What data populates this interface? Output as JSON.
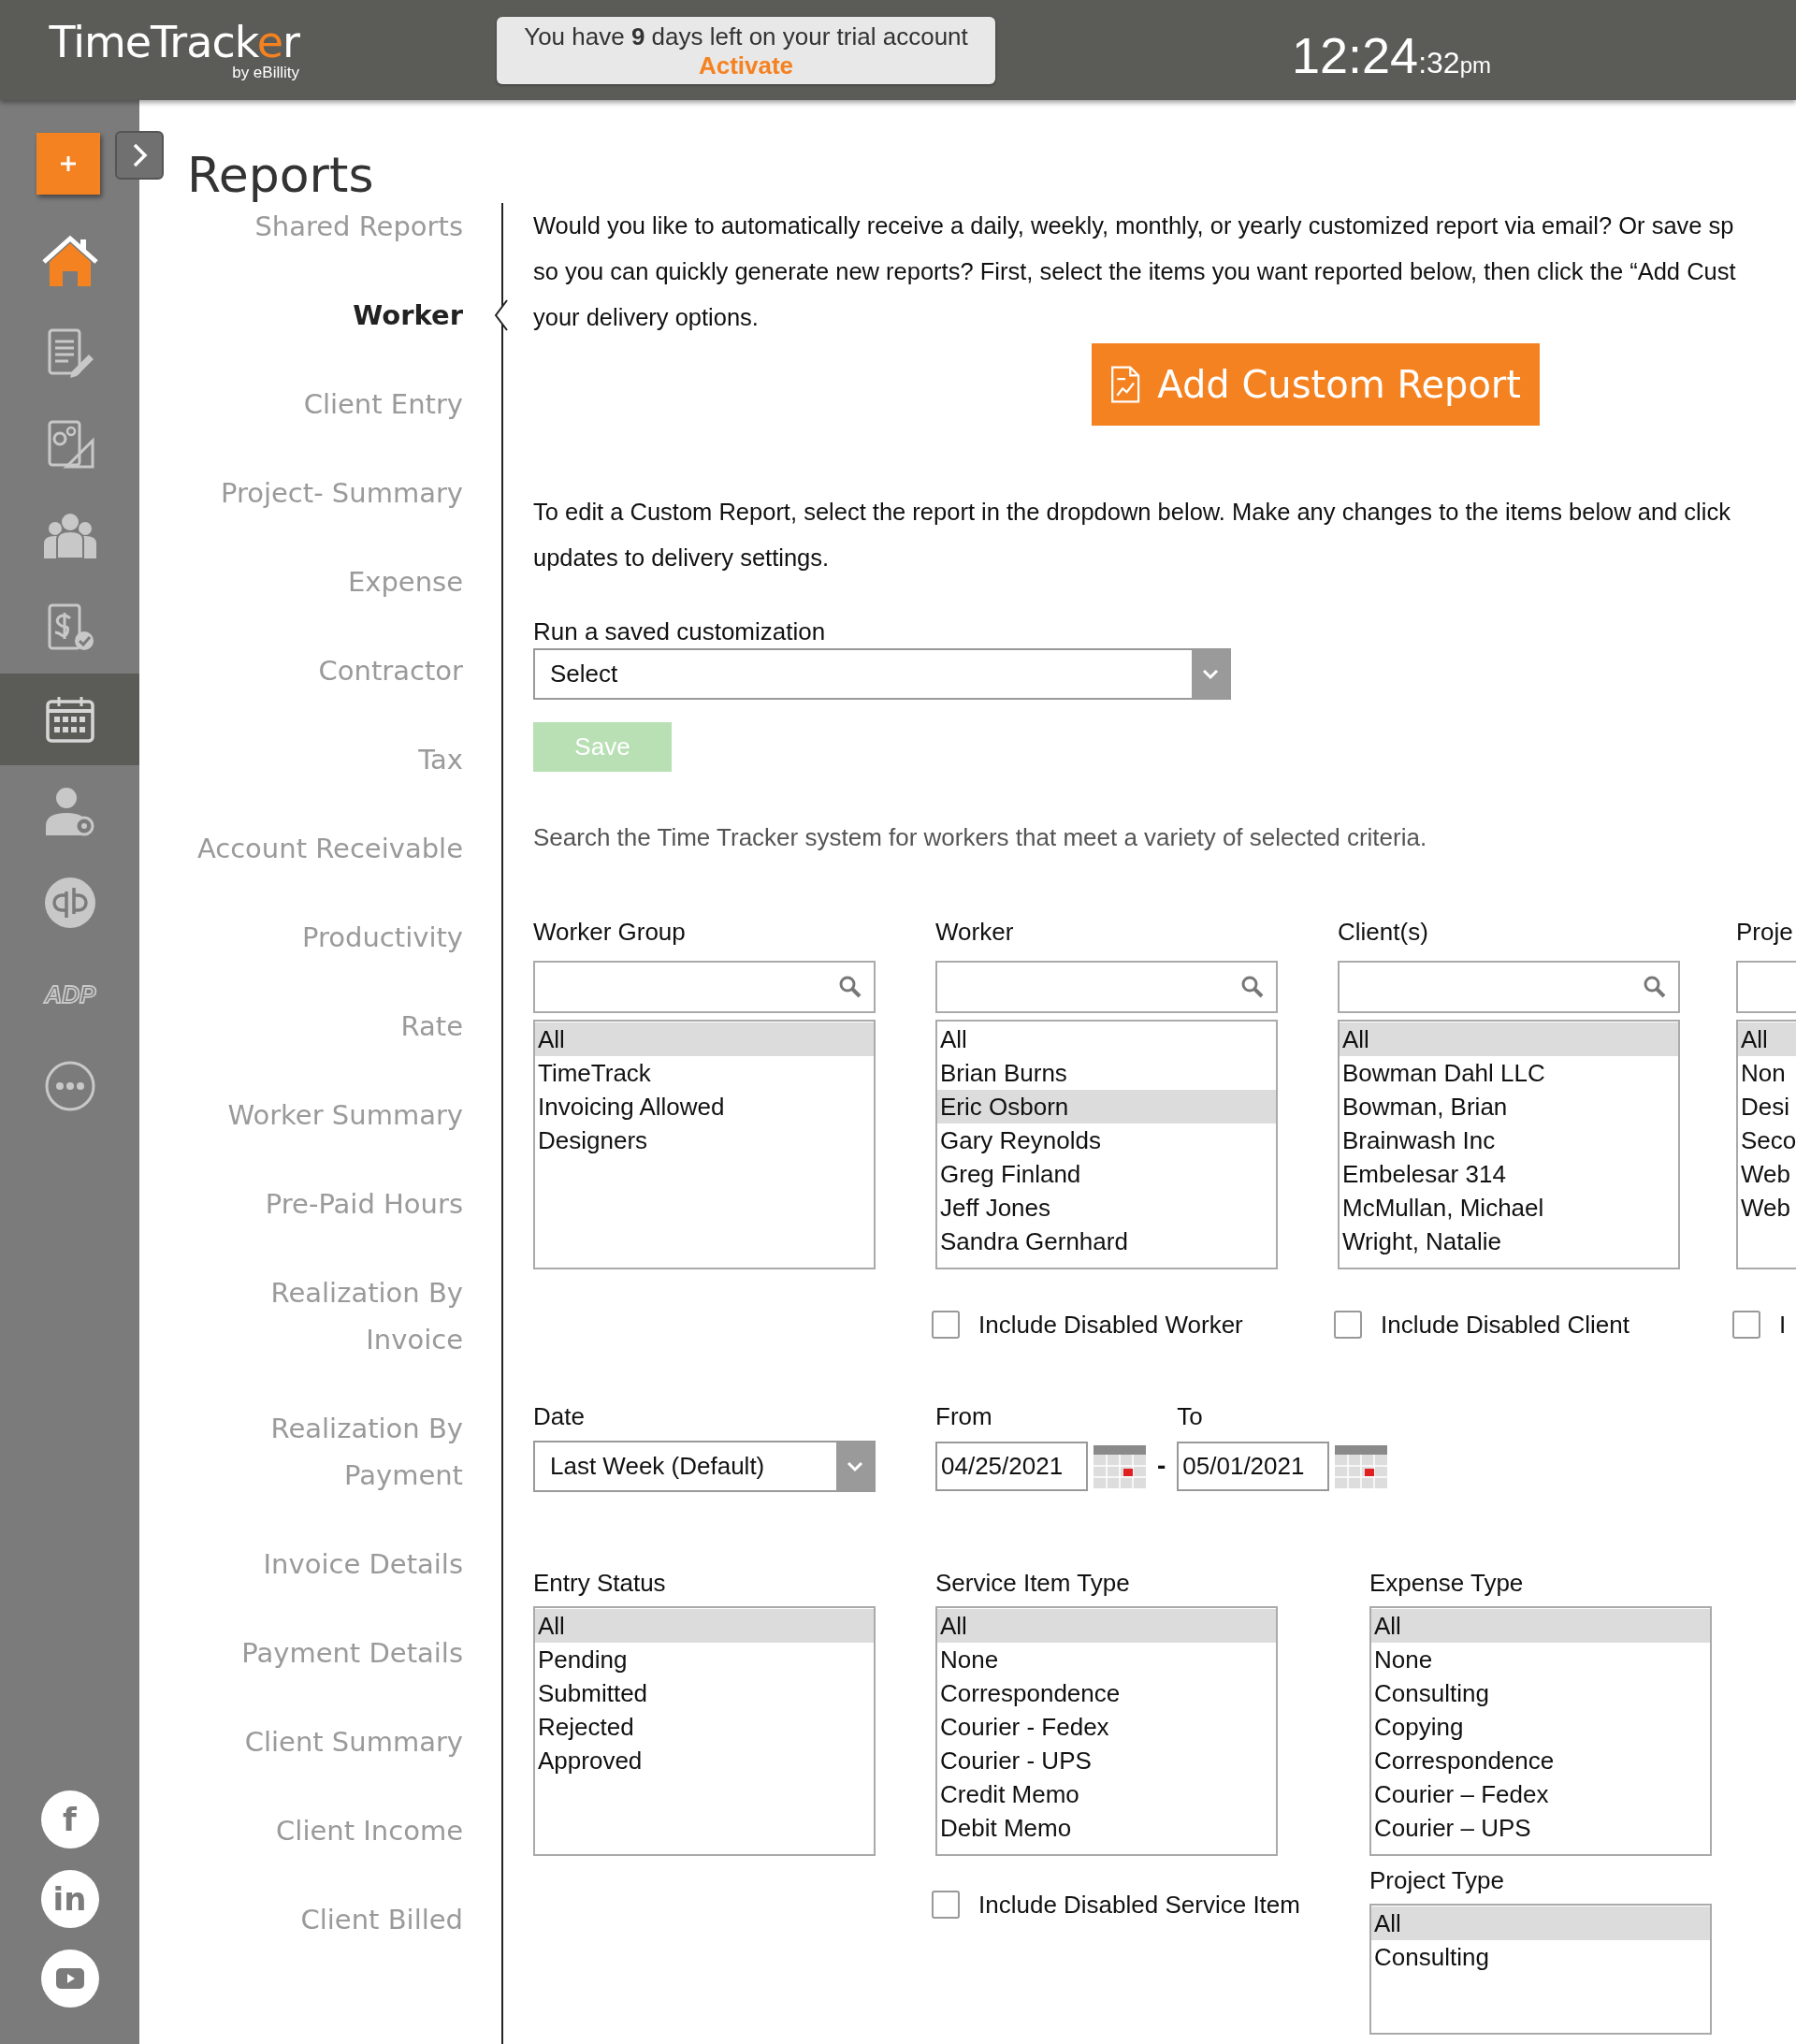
{
  "header": {
    "logo": {
      "before": "TimeTrack",
      "accent": "e",
      "after": "r"
    },
    "logo_subtitle": "by eBillity",
    "trial_message": "You have **9** days left on your trial account",
    "trial_link": "Activate",
    "clock": {
      "time": "12:24",
      "seconds": ":32",
      "period": "pm"
    }
  },
  "rail": {
    "items": [
      {
        "selected": false
      },
      {
        "selected": false
      },
      {
        "selected": false
      },
      {
        "selected": false
      },
      {
        "selected": false
      },
      {
        "selected": true
      },
      {
        "selected": false
      },
      {
        "selected": false
      },
      {
        "selected": false,
        "text": "ADP"
      },
      {
        "selected": false
      }
    ],
    "social": [
      {
        "kind": "letter",
        "text": "f"
      },
      {
        "kind": "letter",
        "text": "in"
      },
      {
        "kind": "play"
      }
    ]
  },
  "page_title": "Reports",
  "nav": [
    {
      "label": "Shared Reports",
      "selected": false
    },
    {
      "label": "Worker",
      "selected": true
    },
    {
      "label": "Client Entry",
      "selected": false
    },
    {
      "label": "Project- Summary",
      "selected": false
    },
    {
      "label": "Expense",
      "selected": false
    },
    {
      "label": "Contractor",
      "selected": false
    },
    {
      "label": "Tax",
      "selected": false
    },
    {
      "label": "Account Receivable",
      "selected": false
    },
    {
      "label": "Productivity",
      "selected": false
    },
    {
      "label": "Rate",
      "selected": false
    },
    {
      "label": "Worker Summary",
      "selected": false
    },
    {
      "label": "Pre-Paid Hours",
      "selected": false
    },
    {
      "label": "Realization By\nInvoice",
      "selected": false
    },
    {
      "label": "Realization By\nPayment",
      "selected": false
    },
    {
      "label": "Invoice Details",
      "selected": false
    },
    {
      "label": "Payment Details",
      "selected": false
    },
    {
      "label": "Client Summary",
      "selected": false
    },
    {
      "label": "Client Income",
      "selected": false
    },
    {
      "label": "Client Billed",
      "selected": false
    }
  ],
  "intro_lines": [
    "Would you like to automatically receive a daily, weekly, monthly, or yearly customized report via email? Or save sp",
    "so you can quickly generate new reports? First, select the items you want reported below, then click the “Add Cust",
    "your delivery options."
  ],
  "add_button": "Add Custom Report",
  "edit_lines": [
    "To edit a Custom Report, select the report in the dropdown below. Make any changes to the items below and click",
    "updates to delivery settings."
  ],
  "saved": {
    "label": "Run a saved customization",
    "value": "Select"
  },
  "save_button": {
    "label": "Save",
    "disabled": true
  },
  "search_hint": "Search the Time Tracker system for workers that meet a variety of selected criteria.",
  "filters": [
    {
      "label": "Worker Group",
      "items": [
        {
          "text": "All",
          "selected": true
        },
        {
          "text": "TimeTrack",
          "selected": false
        },
        {
          "text": "Invoicing Allowed",
          "selected": false
        },
        {
          "text": "Designers",
          "selected": false
        }
      ]
    },
    {
      "label": "Worker",
      "items": [
        {
          "text": "All",
          "selected": false
        },
        {
          "text": "Brian Burns",
          "selected": false
        },
        {
          "text": "Eric Osborn",
          "selected": true
        },
        {
          "text": "Gary Reynolds",
          "selected": false
        },
        {
          "text": "Greg Finland",
          "selected": false
        },
        {
          "text": "Jeff Jones",
          "selected": false
        },
        {
          "text": "Sandra Gernhard",
          "selected": false
        }
      ],
      "checkbox": {
        "label": "Include Disabled Worker",
        "checked": false
      }
    },
    {
      "label": "Client(s)",
      "items": [
        {
          "text": "All",
          "selected": true
        },
        {
          "text": "Bowman Dahl LLC",
          "selected": false
        },
        {
          "text": "Bowman, Brian",
          "selected": false
        },
        {
          "text": "Brainwash Inc",
          "selected": false
        },
        {
          "text": "Embelesar 314",
          "selected": false
        },
        {
          "text": "McMullan, Michael",
          "selected": false
        },
        {
          "text": "Wright, Natalie",
          "selected": false
        }
      ],
      "checkbox": {
        "label": "Include Disabled Client",
        "checked": false
      }
    },
    {
      "label": "Proje",
      "items": [
        {
          "text": "All",
          "selected": true
        },
        {
          "text": "Non",
          "selected": false
        },
        {
          "text": "Desi",
          "selected": false
        },
        {
          "text": "Seco",
          "selected": false
        },
        {
          "text": "Web",
          "selected": false
        },
        {
          "text": "Web",
          "selected": false
        }
      ],
      "checkbox": {
        "label": "I",
        "checked": false
      }
    }
  ],
  "date": {
    "label": "Date",
    "value": "Last Week (Default)",
    "from_label": "From",
    "from": "04/25/2021",
    "separator": "-",
    "to_label": "To",
    "to": "05/01/2021"
  },
  "lower_filters": [
    {
      "label": "Entry Status",
      "items": [
        {
          "text": "All",
          "selected": true
        },
        {
          "text": "Pending",
          "selected": false
        },
        {
          "text": "Submitted",
          "selected": false
        },
        {
          "text": "Rejected",
          "selected": false
        },
        {
          "text": "Approved",
          "selected": false
        }
      ]
    },
    {
      "label": "Service Item Type",
      "items": [
        {
          "text": "All",
          "selected": true
        },
        {
          "text": "None",
          "selected": false
        },
        {
          "text": "Correspondence",
          "selected": false
        },
        {
          "text": "Courier - Fedex",
          "selected": false
        },
        {
          "text": "Courier - UPS",
          "selected": false
        },
        {
          "text": "Credit Memo",
          "selected": false
        },
        {
          "text": "Debit Memo",
          "selected": false
        }
      ],
      "checkbox": {
        "label": "Include Disabled Service Item",
        "checked": false
      }
    },
    {
      "label": "Expense Type",
      "items": [
        {
          "text": "All",
          "selected": true
        },
        {
          "text": "None",
          "selected": false
        },
        {
          "text": "Consulting",
          "selected": false
        },
        {
          "text": "Copying",
          "selected": false
        },
        {
          "text": "Correspondence",
          "selected": false
        },
        {
          "text": "Courier – Fedex",
          "selected": false
        },
        {
          "text": "Courier – UPS",
          "selected": false
        }
      ]
    }
  ],
  "project_type": {
    "label": "Project Type",
    "items": [
      {
        "text": "All",
        "selected": true
      },
      {
        "text": "Consulting",
        "selected": false
      }
    ]
  }
}
